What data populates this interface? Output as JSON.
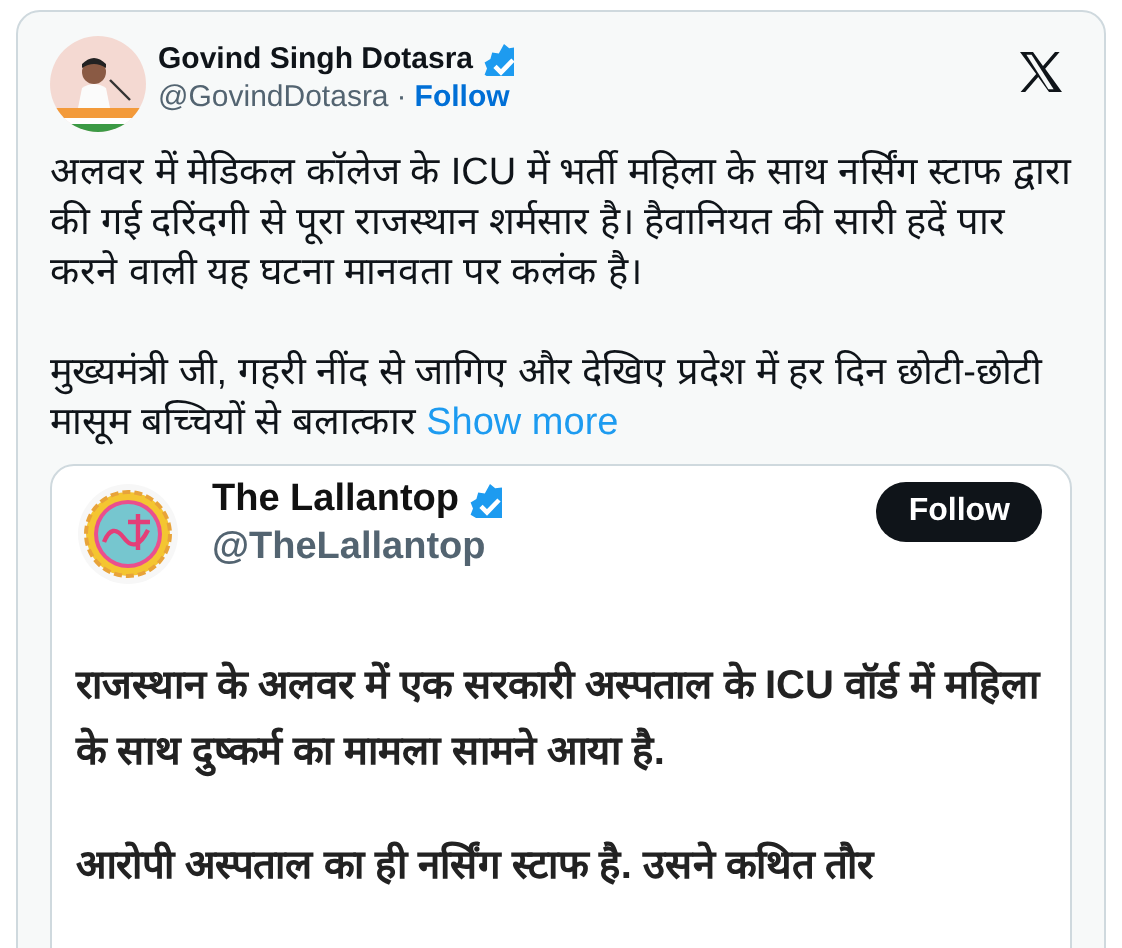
{
  "tweet": {
    "author": {
      "name": "Govind Singh Dotasra",
      "verified": true,
      "handle": "@GovindDotasra",
      "separator": "·",
      "follow": "Follow"
    },
    "paragraphs": [
      "अलवर में मेडिकल कॉलेज के ICU में भर्ती महिला के साथ नर्सिंग स्टाफ द्वारा की गई दरिंदगी से पूरा राजस्थान शर्मसार है। हैवानियत की सारी हदें पार करने वाली यह घटना मानवता पर कलंक है।",
      "मुख्यमंत्री जी, गहरी नींद से जागिए और देखिए प्रदेश में हर दिन छोटी-छोटी मासूम बच्चियों से बलात्कार"
    ],
    "show_more": "Show more",
    "media": {
      "author": {
        "name": "The Lallantop",
        "verified": true,
        "handle": "@TheLallantop",
        "follow": "Follow"
      },
      "paragraphs": [
        "राजस्थान के अलवर में एक सरकारी अस्पताल के **ICU** वॉर्ड में महिला के साथ दुष्कर्म का मामला सामने आया है.",
        "आरोपी अस्पताल का ही नर्सिंग स्टाफ है. उसने कथित तौर"
      ]
    }
  }
}
